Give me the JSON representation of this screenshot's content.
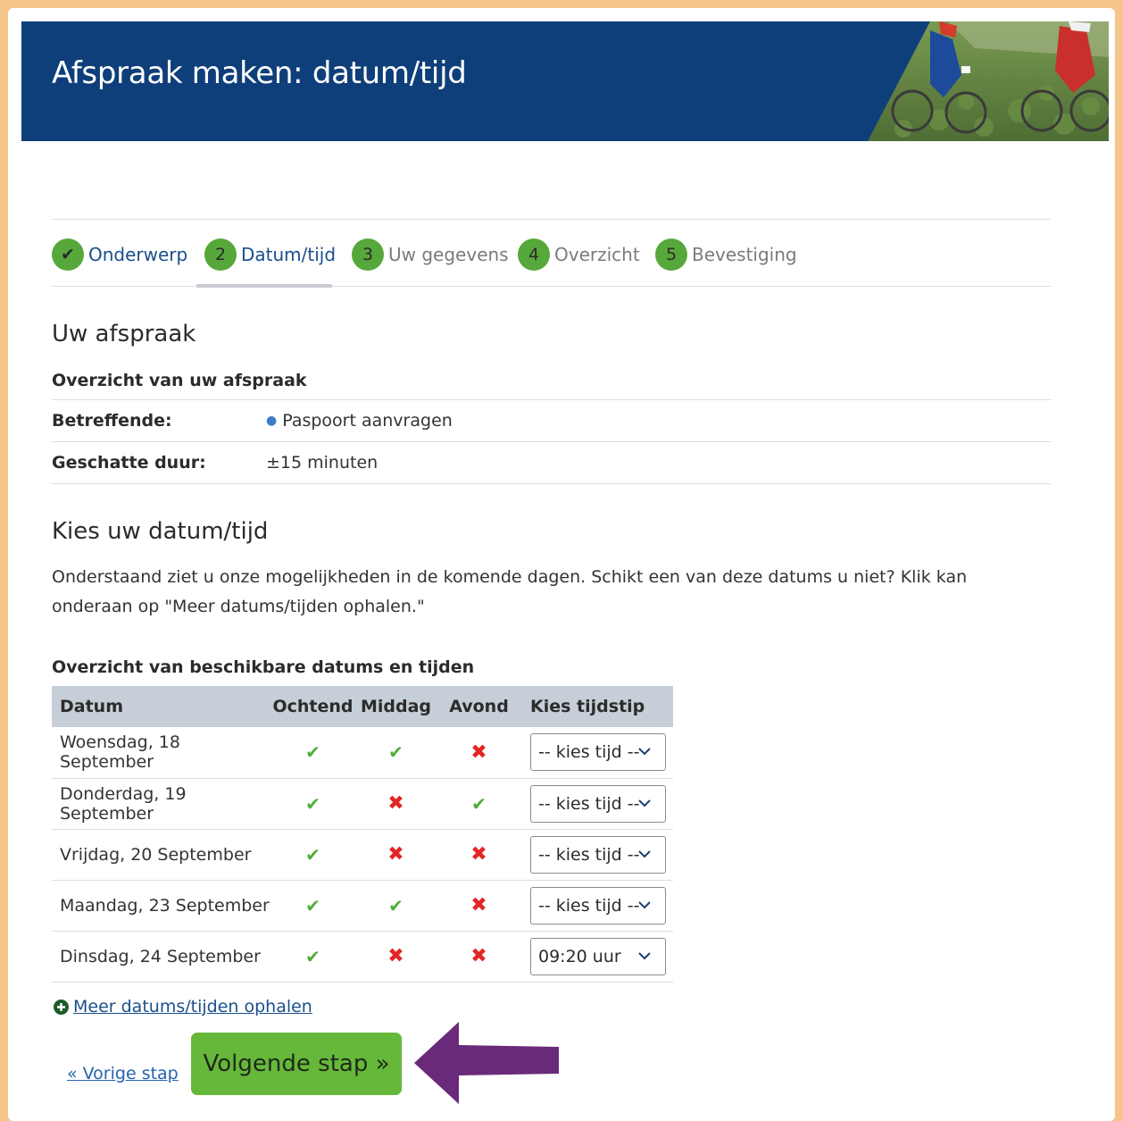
{
  "header": {
    "title": "Afspraak maken: datum/tijd"
  },
  "steps": [
    {
      "num": "✔",
      "label": "Onderwerp",
      "state": "done"
    },
    {
      "num": "2",
      "label": "Datum/tijd",
      "state": "active"
    },
    {
      "num": "3",
      "label": "Uw gegevens",
      "state": "todo"
    },
    {
      "num": "4",
      "label": "Overzicht",
      "state": "todo"
    },
    {
      "num": "5",
      "label": "Bevestiging",
      "state": "todo"
    }
  ],
  "appointment": {
    "heading": "Uw afspraak",
    "overview_label": "Overzicht van uw afspraak",
    "subject_key": "Betreffende:",
    "subject_value": "Paspoort aanvragen",
    "duration_key": "Geschatte duur:",
    "duration_value": "±15 minuten"
  },
  "choose": {
    "heading": "Kies uw datum/tijd",
    "intro": "Onderstaand ziet u onze mogelijkheden in de komende dagen. Schikt een van deze datums u niet? Klik kan onderaan op \"Meer datums/tijden ophalen.\"",
    "table_title": "Overzicht van beschikbare datums en tijden"
  },
  "table": {
    "headers": {
      "date": "Datum",
      "morning": "Ochtend",
      "afternoon": "Middag",
      "evening": "Avond",
      "pick": "Kies tijdstip"
    },
    "rows": [
      {
        "date": "Woensdag, 18 September",
        "morning": true,
        "afternoon": true,
        "evening": false,
        "select": "-- kies tijd --"
      },
      {
        "date": "Donderdag, 19 September",
        "morning": true,
        "afternoon": false,
        "evening": true,
        "select": "-- kies tijd --"
      },
      {
        "date": "Vrijdag, 20 September",
        "morning": true,
        "afternoon": false,
        "evening": false,
        "select": "-- kies tijd --"
      },
      {
        "date": "Maandag, 23 September",
        "morning": true,
        "afternoon": true,
        "evening": false,
        "select": "-- kies tijd --"
      },
      {
        "date": "Dinsdag, 24 September",
        "morning": true,
        "afternoon": false,
        "evening": false,
        "select": "09:20 uur"
      }
    ],
    "tick_glyph": "✔",
    "cross_glyph": "✖"
  },
  "actions": {
    "more_link": "Meer datums/tijden ophalen",
    "prev_link": "« Vorige stap",
    "next_button": "Volgende stap »"
  },
  "colors": {
    "frame": "#f5c58a",
    "header_bg": "#0f3f7a",
    "step_green": "#57a83a",
    "button_green": "#66b83a",
    "arrow_purple": "#6a2a7a",
    "table_header_bg": "#c6ced8"
  }
}
